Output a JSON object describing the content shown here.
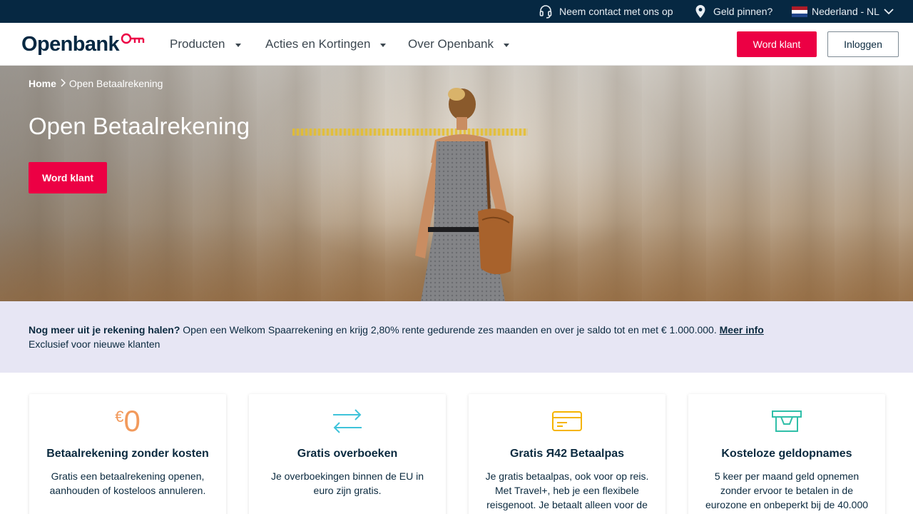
{
  "topbar": {
    "contact_label": "Neem contact met ons op",
    "atm_label": "Geld pinnen?",
    "language_label": "Nederland - NL"
  },
  "header": {
    "logo_text": "Openbank",
    "nav": [
      {
        "label": "Producten"
      },
      {
        "label": "Acties en Kortingen"
      },
      {
        "label": "Over Openbank"
      }
    ],
    "signup_label": "Word klant",
    "login_label": "Inloggen"
  },
  "hero": {
    "breadcrumb_home": "Home",
    "breadcrumb_current": "Open Betaalrekening",
    "title": "Open Betaalrekening",
    "cta_label": "Word klant"
  },
  "promo": {
    "bold": "Nog meer uit je rekening halen?",
    "text": " Open een Welkom Spaarrekening en krijg 2,80% rente gedurende zes maanden en over je saldo tot en met € 1.000.000. ",
    "link": "Meer info",
    "subtext": "Exclusief voor nieuwe klanten"
  },
  "features": [
    {
      "icon": "euro-zero-icon",
      "icon_symbol": "€",
      "icon_number": "0",
      "title": "Betaalrekening zonder kosten",
      "text": "Gratis een betaalrekening openen, aanhouden of kosteloos annuleren."
    },
    {
      "icon": "transfer-arrows-icon",
      "title": "Gratis overboeken",
      "text": "Je overboekingen binnen de EU in euro zijn gratis."
    },
    {
      "icon": "credit-card-icon",
      "title": "Gratis Я42 Betaalpas",
      "text": "Je gratis betaalpas, ook voor op reis. Met Travel+, heb je een flexibele reisgenoot. Je betaalt alleen voor de"
    },
    {
      "icon": "atm-withdrawal-icon",
      "title": "Kosteloze geldopnames",
      "text": "5 keer per maand geld opnemen zonder ervoor te betalen in de eurozone en onbeperkt bij de 40.000"
    }
  ],
  "colors": {
    "navy": "#062842",
    "brand_red": "#ec0044",
    "promo_bg": "#e7e6f4",
    "icon_orange": "#f29a5c",
    "icon_cyan": "#3fc3da",
    "icon_yellow": "#f5b400",
    "icon_teal": "#2fbfa8"
  }
}
